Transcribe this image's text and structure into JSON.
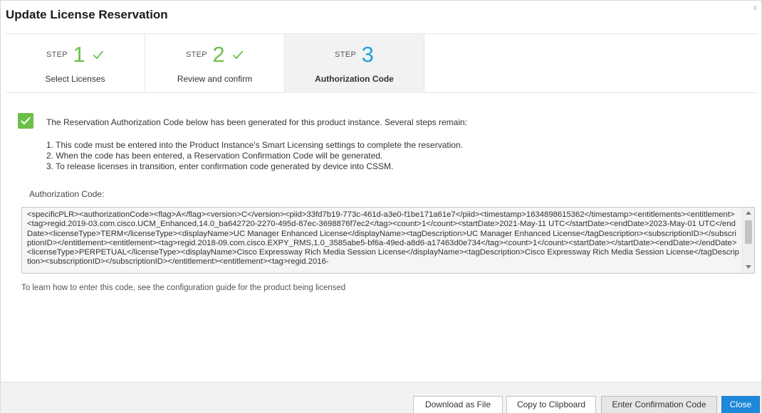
{
  "dialog": {
    "title": "Update License Reservation",
    "close_label": "x"
  },
  "wizard": {
    "step_word": "STEP",
    "steps": [
      {
        "number": "1",
        "label": "Select Licenses",
        "completed": true
      },
      {
        "number": "2",
        "label": "Review and confirm",
        "completed": true
      },
      {
        "number": "3",
        "label": "Authorization Code",
        "completed": false,
        "active": true
      }
    ]
  },
  "content": {
    "message": "The Reservation Authorization Code below has been generated for this product instance. Several steps remain:",
    "steps": [
      "1. This code must be entered into the Product Instance's Smart Licensing settings to complete the reservation.",
      "2. When the code has been entered, a Reservation Confirmation Code will be generated.",
      "3. To release licenses in transition, enter confirmation code generated by device into CSSM."
    ],
    "auth_code_label": "Authorization Code:",
    "auth_code": "<specificPLR><authorizationCode><flag>A</flag><version>C</version><piid>33fd7b19-773c-461d-a3e0-f1be171a61e7</piid><timestamp>1634898615362</timestamp><entitlements><entitlement><tag>regid.2019-03.com.cisco.UCM_Enhanced,14.0_ba642720-2270-495d-87ec-3698876f7ec2</tag><count>1</count><startDate>2021-May-11 UTC</startDate><endDate>2023-May-01 UTC</endDate><licenseType>TERM</licenseType><displayName>UC Manager Enhanced License</displayName><tagDescription>UC Manager Enhanced License</tagDescription><subscriptionID></subscriptionID></entitlement><entitlement><tag>regid.2018-09.com.cisco.EXPY_RMS,1.0_3585abe5-bf6a-49ed-a8d6-a17463d0e734</tag><count>1</count><startDate></startDate><endDate></endDate><licenseType>PERPETUAL</licenseType><displayName>Cisco Expressway Rich Media Session License</displayName><tagDescription>Cisco Expressway Rich Media Session License</tagDescription><subscriptionID></subscriptionID></entitlement><entitlement><tag>regid.2016-",
    "help_text": "To learn how to enter this code, see the configuration guide for the product being licensed"
  },
  "footer": {
    "download_label": "Download as File",
    "copy_label": "Copy to Clipboard",
    "enter_confirmation_label": "Enter Confirmation Code",
    "close_label": "Close"
  },
  "colors": {
    "accent_blue": "#22a0dc",
    "success_green": "#6cc04a",
    "primary_button": "#1e88d9"
  }
}
